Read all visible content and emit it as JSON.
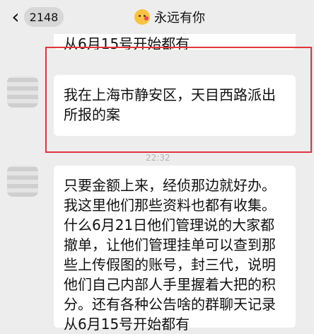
{
  "header": {
    "unread_count": "2148",
    "title": "永远有你"
  },
  "chat": {
    "partial_top_message_line": "从6月15号开始都有",
    "message_highlighted": {
      "lines": [
        "我在上海市静安区，天目西路派出",
        "所报的案"
      ]
    },
    "timestamp_partial": "22:32",
    "message_long": {
      "lines": [
        "只要金额上来，经侦那边就好办。",
        "我这里他们那些资料也都有收集。",
        "什么6月21日他们管理说的大家都",
        "撤单，让他们管理挂单可以查到那",
        "些上传假图的账号，封三代，说明",
        "他们自己内部人手里握着大把的积",
        "分。还有各种公告啥的群聊天记录",
        "从6月15号开始都有"
      ]
    }
  },
  "colors": {
    "background": "#ededed",
    "bubble": "#ffffff",
    "highlight": "#e3333b"
  },
  "icons": {
    "back": "chevron-left-icon",
    "title_emoji": "emoji-icon"
  }
}
